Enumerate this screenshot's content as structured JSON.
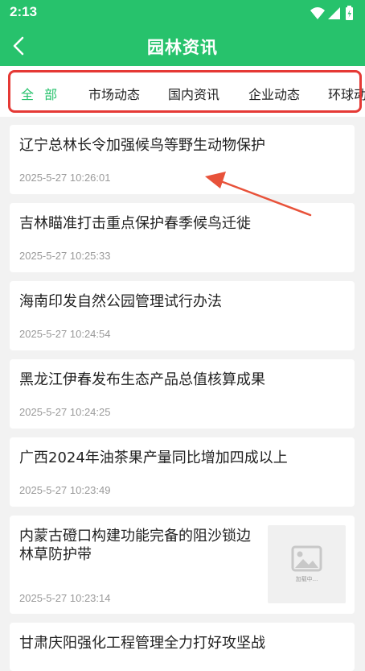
{
  "status_bar": {
    "time": "2:13"
  },
  "header": {
    "title": "园林资讯"
  },
  "tabs": [
    {
      "label": "全 部",
      "active": true
    },
    {
      "label": "市场动态",
      "active": false
    },
    {
      "label": "国内资讯",
      "active": false
    },
    {
      "label": "企业动态",
      "active": false
    },
    {
      "label": "环球动",
      "active": false
    }
  ],
  "articles": [
    {
      "title": "辽宁总林长令加强候鸟等野生动物保护",
      "time": "2025-5-27 10:26:01"
    },
    {
      "title": "吉林瞄准打击重点保护春季候鸟迁徙",
      "time": "2025-5-27 10:25:33"
    },
    {
      "title": "海南印发自然公园管理试行办法",
      "time": "2025-5-27 10:24:54"
    },
    {
      "title": "黑龙江伊春发布生态产品总值核算成果",
      "time": "2025-5-27 10:24:25"
    },
    {
      "title": "广西2024年油茶果产量同比增加四成以上",
      "time": "2025-5-27 10:23:49"
    },
    {
      "title_line1": "内蒙古磴口构建功能完备的阻沙锁边",
      "title_line2": "林草防护带",
      "time": "2025-5-27 10:23:14",
      "thumb_label": "加载中..."
    },
    {
      "title": "甘肃庆阳强化工程管理全力打好攻坚战"
    }
  ],
  "colors": {
    "brand": "#27c26c",
    "highlight": "#e53935",
    "arrow": "#e8523a"
  }
}
